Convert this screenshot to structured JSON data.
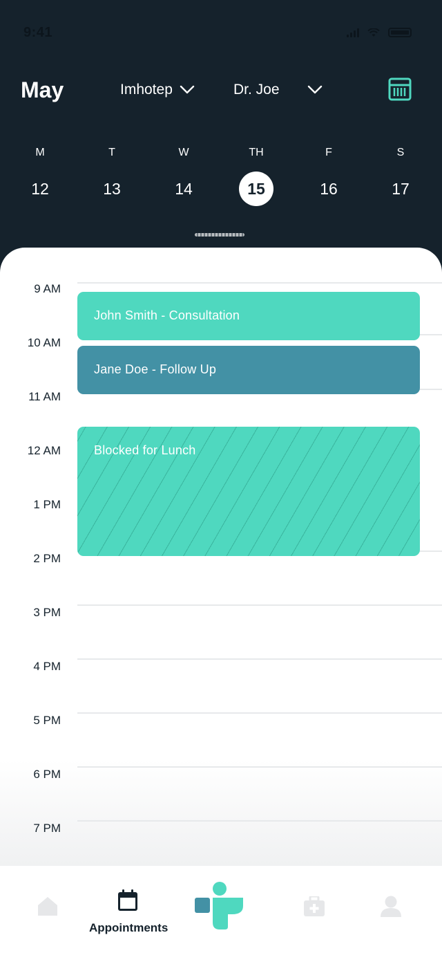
{
  "status_bar": {
    "time": "9:41"
  },
  "header": {
    "month": "May",
    "location": "Imhotep",
    "provider": "Dr. Joe"
  },
  "week": [
    {
      "name": "M",
      "date": "12",
      "selected": false
    },
    {
      "name": "T",
      "date": "13",
      "selected": false
    },
    {
      "name": "W",
      "date": "14",
      "selected": false
    },
    {
      "name": "TH",
      "date": "15",
      "selected": true
    },
    {
      "name": "F",
      "date": "16",
      "selected": false
    },
    {
      "name": "S",
      "date": "17",
      "selected": false
    }
  ],
  "schedule": {
    "hours": [
      "9 AM",
      "10 AM",
      "11 AM",
      "12 AM",
      "1 PM",
      "2 PM",
      "3 PM",
      "4 PM",
      "5 PM",
      "6 PM",
      "7 PM"
    ],
    "events": [
      {
        "title": "John Smith - Consultation",
        "color": "#4fd8bf"
      },
      {
        "title": "Jane Doe - Follow Up",
        "color": "#4391a5"
      },
      {
        "title": "Blocked for Lunch",
        "color": "#4fd8bf",
        "style": "hatched"
      }
    ]
  },
  "tabbar": {
    "tabs": [
      {
        "icon": "home-icon",
        "label": "",
        "active": false
      },
      {
        "icon": "calendar-icon",
        "label": "Appointments",
        "active": true
      },
      {
        "icon": "brand-logo-icon",
        "label": "",
        "active": false
      },
      {
        "icon": "medical-kit-icon",
        "label": "",
        "active": false
      },
      {
        "icon": "profile-icon",
        "label": "",
        "active": false
      }
    ]
  },
  "colors": {
    "header_bg": "#15222c",
    "accent_teal": "#4fd8bf",
    "accent_blue": "#4391a5",
    "text_dark": "#15222c"
  }
}
